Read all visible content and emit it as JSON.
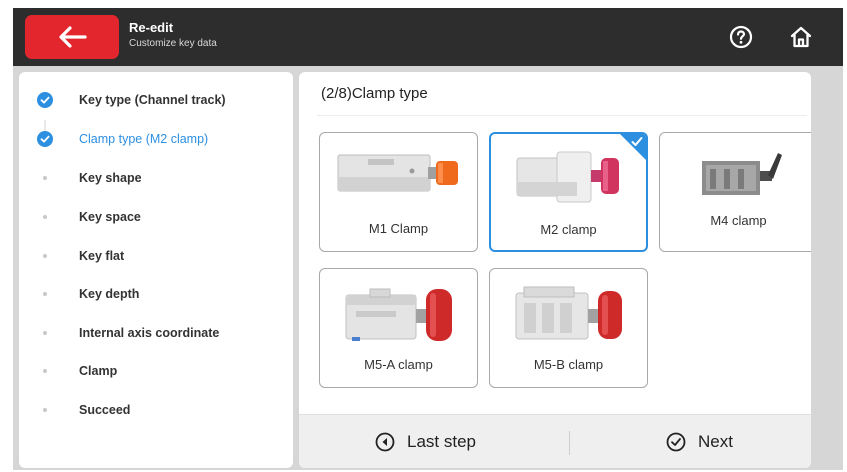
{
  "header": {
    "title": "Re-edit",
    "subtitle": "Customize key data",
    "back_icon": "arrow-left-icon",
    "help_icon": "help-circle-icon",
    "home_icon": "home-icon",
    "colors": {
      "bar": "#2d2d2d",
      "back_button": "#e3262d"
    }
  },
  "sidebar": {
    "steps": [
      {
        "label": "Key type (Channel track)",
        "state": "done"
      },
      {
        "label": "Clamp type (M2 clamp)",
        "state": "current"
      },
      {
        "label": "Key shape",
        "state": "pending"
      },
      {
        "label": "Key space",
        "state": "pending"
      },
      {
        "label": "Key flat",
        "state": "pending"
      },
      {
        "label": "Key depth",
        "state": "pending"
      },
      {
        "label": "Internal axis coordinate",
        "state": "pending"
      },
      {
        "label": "Clamp",
        "state": "pending"
      },
      {
        "label": "Succeed",
        "state": "pending"
      }
    ],
    "accent_color": "#2d8fe0"
  },
  "main": {
    "section_title": "(2/8)Clamp type",
    "clamps": [
      {
        "label": "M1 Clamp",
        "selected": false
      },
      {
        "label": "M2 clamp",
        "selected": true
      },
      {
        "label": "M4 clamp",
        "selected": false
      },
      {
        "label": "M5-A clamp",
        "selected": false
      },
      {
        "label": "M5-B clamp",
        "selected": false
      }
    ]
  },
  "footer": {
    "last_label": "Last step",
    "next_label": "Next",
    "last_icon": "circle-arrow-left-icon",
    "next_icon": "circle-check-icon"
  }
}
